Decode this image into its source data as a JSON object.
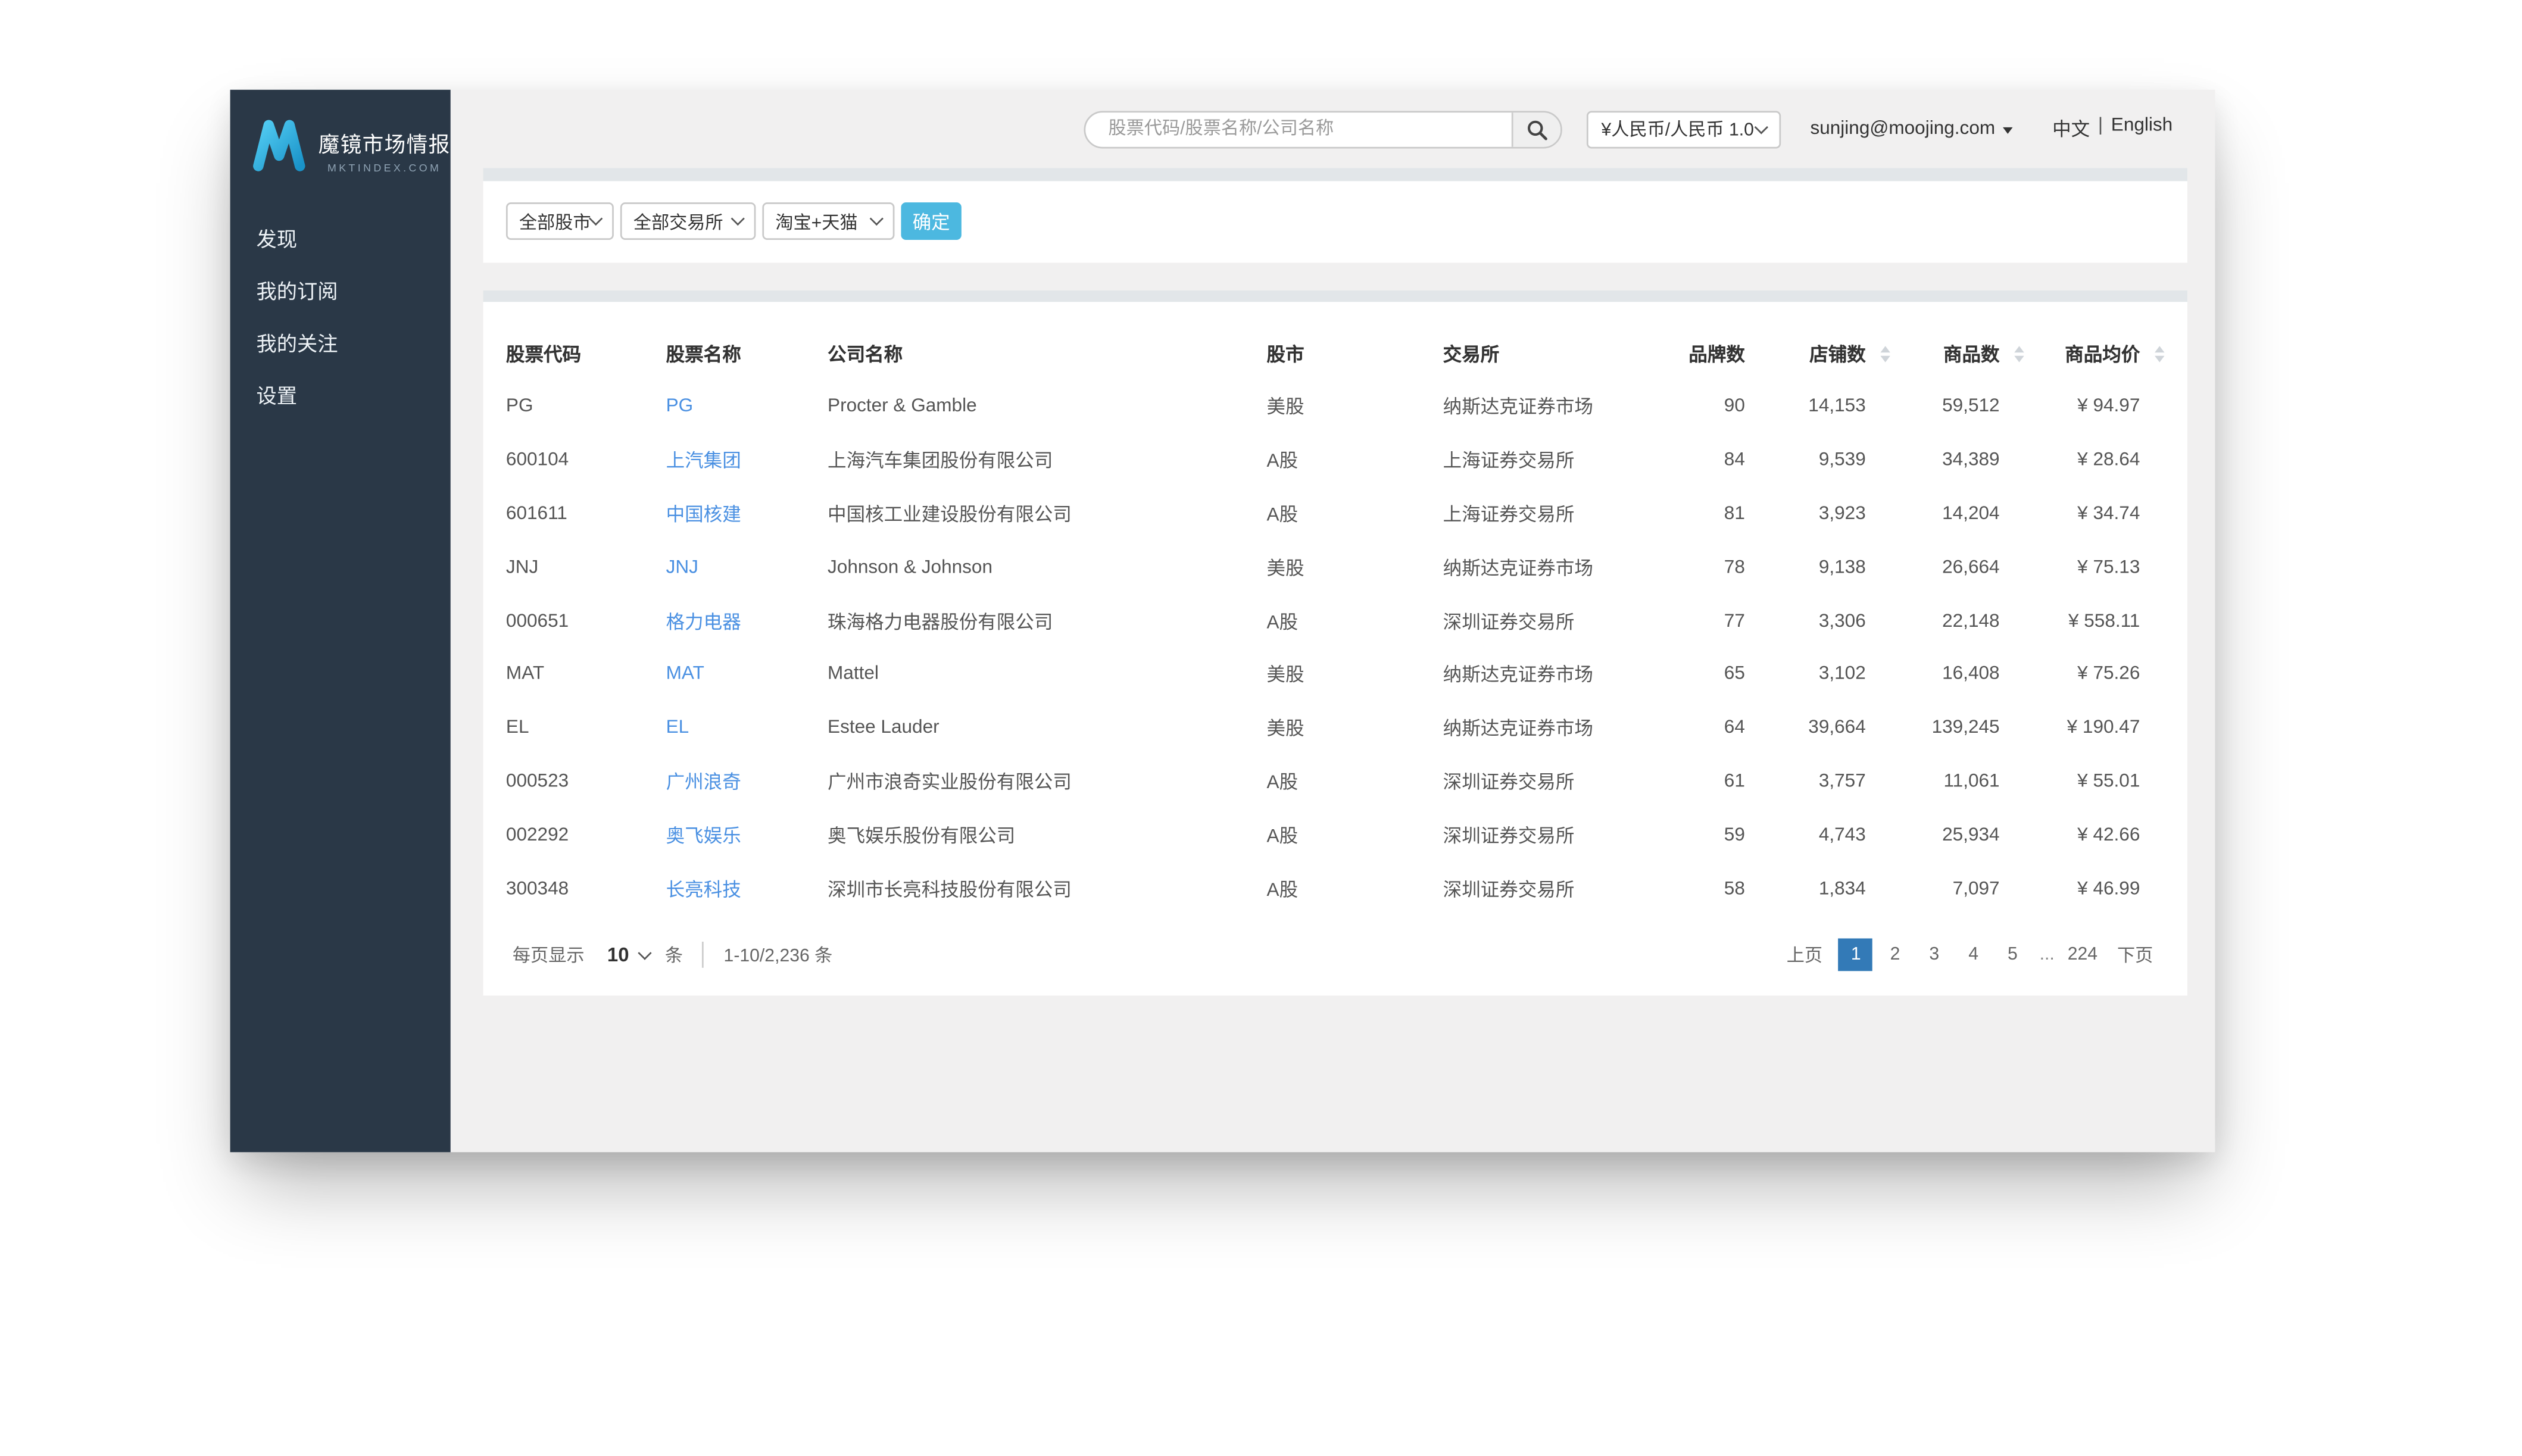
{
  "colors": {
    "sidebar_bg": "#2a3847",
    "main_bg": "#f1f0f0",
    "card_strip": "#e2e6e9",
    "link_blue": "#4a90e2",
    "active_page_blue": "#337ab7",
    "confirm_cyan": "#4cb8e0",
    "logo_cyan": "#2fb3e0"
  },
  "sidebar": {
    "logo_title": "魔镜市场情报",
    "logo_subtitle": "MKTINDEX.COM",
    "items": [
      {
        "label": "发现"
      },
      {
        "label": "我的订阅"
      },
      {
        "label": "我的关注"
      },
      {
        "label": "设置"
      }
    ]
  },
  "topbar": {
    "search_placeholder": "股票代码/股票名称/公司名称",
    "currency_value": "¥人民币/人民币 1.0",
    "user_email": "sunjing@moojing.com",
    "lang_zh": "中文",
    "lang_sep": "|",
    "lang_en": "English"
  },
  "filters": {
    "market": "全部股市",
    "exchange": "全部交易所",
    "platform": "淘宝+天猫",
    "submit": "确定"
  },
  "table": {
    "headers": {
      "code": "股票代码",
      "name": "股票名称",
      "company": "公司名称",
      "market": "股市",
      "exchange": "交易所",
      "brands": "品牌数",
      "shops": "店铺数",
      "products": "商品数",
      "price": "商品均价"
    },
    "rows": [
      {
        "code": "PG",
        "name": "PG",
        "company": "Procter & Gamble",
        "market": "美股",
        "exchange": "纳斯达克证券市场",
        "brands": "90",
        "shops": "14,153",
        "products": "59,512",
        "price": "¥ 94.97"
      },
      {
        "code": "600104",
        "name": "上汽集团",
        "company": "上海汽车集团股份有限公司",
        "market": "A股",
        "exchange": "上海证券交易所",
        "brands": "84",
        "shops": "9,539",
        "products": "34,389",
        "price": "¥ 28.64"
      },
      {
        "code": "601611",
        "name": "中国核建",
        "company": "中国核工业建设股份有限公司",
        "market": "A股",
        "exchange": "上海证券交易所",
        "brands": "81",
        "shops": "3,923",
        "products": "14,204",
        "price": "¥ 34.74"
      },
      {
        "code": "JNJ",
        "name": "JNJ",
        "company": "Johnson & Johnson",
        "market": "美股",
        "exchange": "纳斯达克证券市场",
        "brands": "78",
        "shops": "9,138",
        "products": "26,664",
        "price": "¥ 75.13"
      },
      {
        "code": "000651",
        "name": "格力电器",
        "company": "珠海格力电器股份有限公司",
        "market": "A股",
        "exchange": "深圳证券交易所",
        "brands": "77",
        "shops": "3,306",
        "products": "22,148",
        "price": "¥ 558.11"
      },
      {
        "code": "MAT",
        "name": "MAT",
        "company": "Mattel",
        "market": "美股",
        "exchange": "纳斯达克证券市场",
        "brands": "65",
        "shops": "3,102",
        "products": "16,408",
        "price": "¥ 75.26"
      },
      {
        "code": "EL",
        "name": "EL",
        "company": "Estee Lauder",
        "market": "美股",
        "exchange": "纳斯达克证券市场",
        "brands": "64",
        "shops": "39,664",
        "products": "139,245",
        "price": "¥ 190.47"
      },
      {
        "code": "000523",
        "name": "广州浪奇",
        "company": "广州市浪奇实业股份有限公司",
        "market": "A股",
        "exchange": "深圳证券交易所",
        "brands": "61",
        "shops": "3,757",
        "products": "11,061",
        "price": "¥ 55.01"
      },
      {
        "code": "002292",
        "name": "奥飞娱乐",
        "company": "奥飞娱乐股份有限公司",
        "market": "A股",
        "exchange": "深圳证券交易所",
        "brands": "59",
        "shops": "4,743",
        "products": "25,934",
        "price": "¥ 42.66"
      },
      {
        "code": "300348",
        "name": "长亮科技",
        "company": "深圳市长亮科技股份有限公司",
        "market": "A股",
        "exchange": "深圳证券交易所",
        "brands": "58",
        "shops": "1,834",
        "products": "7,097",
        "price": "¥ 46.99"
      }
    ]
  },
  "pagination": {
    "per_page_label": "每页显示",
    "per_page_value": "10",
    "unit": "条",
    "range": "1-10/2,236 条",
    "prev": "上页",
    "pages": [
      {
        "label": "1",
        "active": true
      },
      {
        "label": "2"
      },
      {
        "label": "3"
      },
      {
        "label": "4"
      },
      {
        "label": "5"
      }
    ],
    "ellipsis": "...",
    "last_page": "224",
    "next": "下页"
  }
}
